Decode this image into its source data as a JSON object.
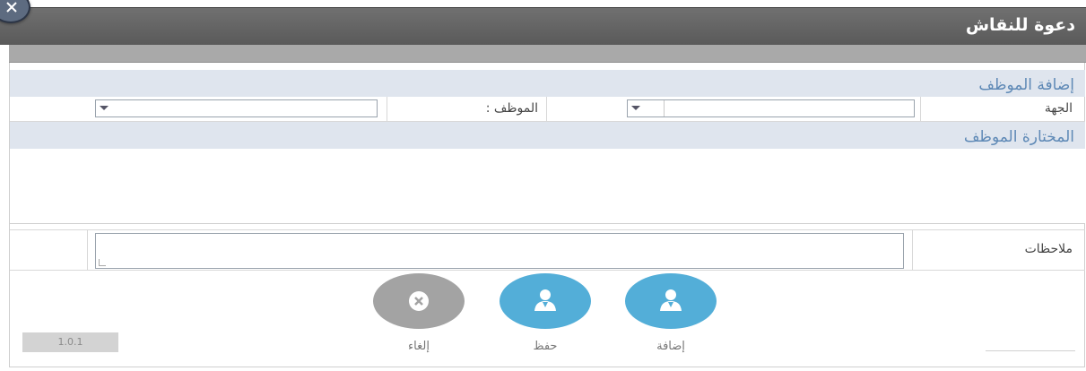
{
  "dialog": {
    "title": "دعوة للنقاش"
  },
  "add_employee_section": {
    "heading": "إضافة الموظف",
    "department_label": "الجهة",
    "department_value": "",
    "employee_label": "الموظف :",
    "employee_value": ""
  },
  "selected_section": {
    "heading": "المختارة الموظف"
  },
  "notes": {
    "label": "ملاحظات",
    "value": ""
  },
  "actions": {
    "add_label": "إضافة",
    "save_label": "حفظ",
    "cancel_label": "إلغاء"
  },
  "footer": {
    "version": "1.0.1"
  },
  "colors": {
    "titlebar": "#5a5a5a",
    "section_header_bg": "#dfe5ee",
    "section_header_text": "#5e89b6",
    "action_blue": "#53aed8",
    "action_grey": "#a3a3a3"
  },
  "icons": {
    "close": "close-icon",
    "add": "user-add-icon",
    "save": "user-save-icon",
    "cancel": "cancel-x-icon"
  }
}
